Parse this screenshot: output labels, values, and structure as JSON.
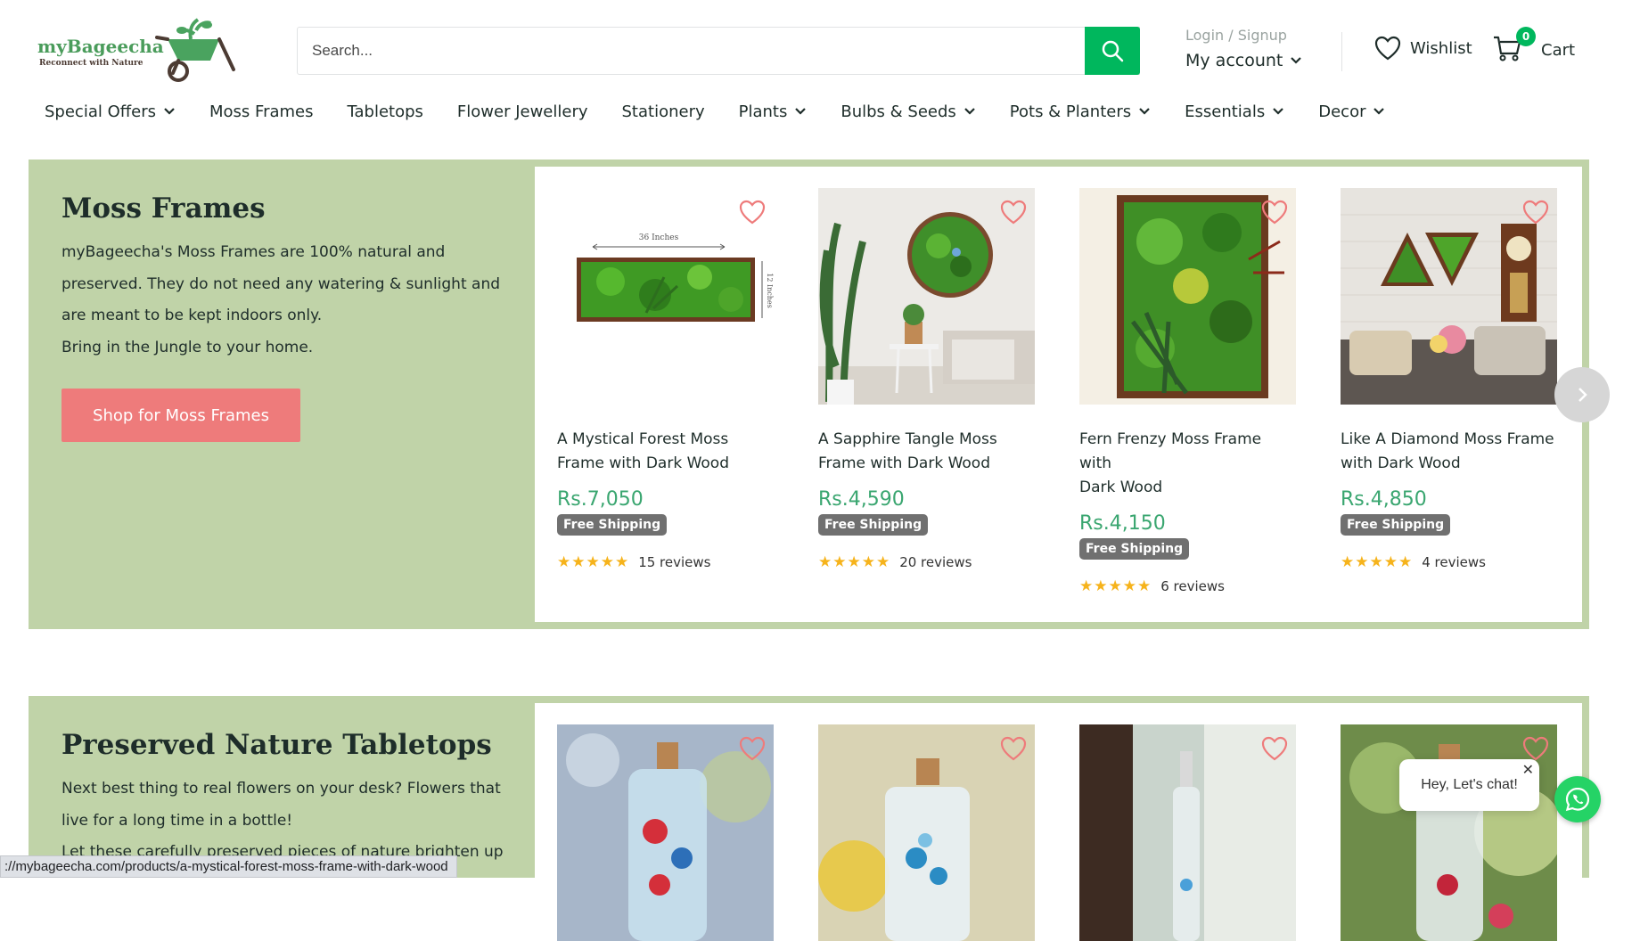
{
  "brand": {
    "name": "myBageecha",
    "tagline": "Reconnect with Nature"
  },
  "search": {
    "placeholder": "Search..."
  },
  "account": {
    "login_label": "Login / Signup",
    "my_account_label": "My account"
  },
  "wishlist": {
    "label": "Wishlist"
  },
  "cart": {
    "label": "Cart",
    "count": "0"
  },
  "nav": {
    "items": [
      {
        "label": "Special Offers",
        "has_dropdown": true
      },
      {
        "label": "Moss Frames",
        "has_dropdown": false
      },
      {
        "label": "Tabletops",
        "has_dropdown": false
      },
      {
        "label": "Flower Jewellery",
        "has_dropdown": false
      },
      {
        "label": "Stationery",
        "has_dropdown": false
      },
      {
        "label": "Plants",
        "has_dropdown": true
      },
      {
        "label": "Bulbs & Seeds",
        "has_dropdown": true
      },
      {
        "label": "Pots & Planters",
        "has_dropdown": true
      },
      {
        "label": "Essentials",
        "has_dropdown": true
      },
      {
        "label": "Decor",
        "has_dropdown": true
      }
    ]
  },
  "section1": {
    "title": "Moss Frames",
    "description": [
      "myBageecha's Moss Frames are 100% natural and",
      "preserved. They do not need any watering & sunlight and",
      "are meant to be kept indoors only.",
      "Bring in the Jungle to your home."
    ],
    "button_label": "Shop for Moss Frames",
    "products": [
      {
        "title_line1": "A Mystical Forest Moss",
        "title_line2": "Frame with Dark Wood",
        "price": "Rs.7,050",
        "badge": "Free Shipping",
        "rating": 5,
        "reviews": "15 reviews",
        "image_label_width": "36 Inches",
        "image_label_height": "12 Inches"
      },
      {
        "title_line1": "A Sapphire Tangle Moss",
        "title_line2": "Frame with Dark Wood",
        "price": "Rs.4,590",
        "badge": "Free Shipping",
        "rating": 5,
        "reviews": "20 reviews"
      },
      {
        "title_line1": "Fern Frenzy Moss Frame with",
        "title_line2": "Dark Wood",
        "price": "Rs.4,150",
        "badge": "Free Shipping",
        "rating": 5,
        "reviews": "6 reviews"
      },
      {
        "title_line1": "Like A Diamond Moss Frame",
        "title_line2": "with Dark Wood",
        "price": "Rs.4,850",
        "badge": "Free Shipping",
        "rating": 5,
        "reviews": "4 reviews"
      }
    ]
  },
  "section2": {
    "title": "Preserved Nature Tabletops",
    "description": [
      "Next best thing to real flowers on your desk? Flowers that",
      "live for a long time in a bottle!",
      "Let these carefully preserved pieces of nature brighten up"
    ]
  },
  "chat": {
    "bubble_text": "Hey, Let's chat!",
    "close_glyph": "✕"
  },
  "status_bar": {
    "url": "://mybageecha.com/products/a-mystical-forest-moss-frame-with-dark-wood"
  },
  "colors": {
    "brand_green": "#00b75d",
    "section_bg": "#c0d3a8",
    "button_coral": "#ee7b7b",
    "price_green": "#3aa670",
    "star": "#f6b31b"
  }
}
